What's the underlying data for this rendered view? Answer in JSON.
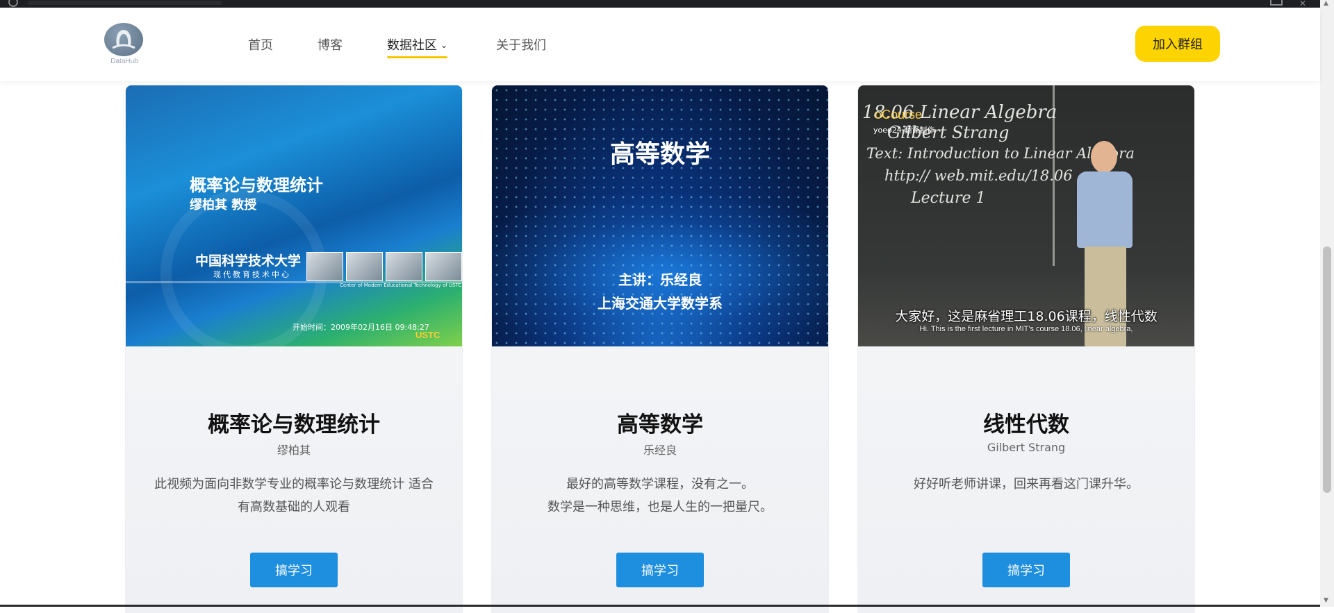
{
  "navbar": {
    "logo_text": "DataHub",
    "items": [
      {
        "label": "首页"
      },
      {
        "label": "博客"
      },
      {
        "label": "数据社区"
      },
      {
        "label": "关于我们"
      }
    ],
    "join_button": "加入群组"
  },
  "cards": [
    {
      "thumb": {
        "title": "概率论与数理统计",
        "subtitle": "缪柏其 教授",
        "org_cn": "中国科学技术大学",
        "org_cn2": "现代教育技术中心",
        "org_en": "Center of Modern Educational Technology of USTC",
        "time": "开始时间：2009年02月16日 09:48:27",
        "mark": "USTC"
      },
      "title": "概率论与数理统计",
      "author": "缪柏其",
      "desc": "此视频为面向非数学专业的概率论与数理统计 适合有高数基础的人观看",
      "button": "搞学习"
    },
    {
      "thumb": {
        "title": "高等数学",
        "line1": "主讲：乐经良",
        "line2": "上海交通大学数学系"
      },
      "title": "高等数学",
      "author": "乐经良",
      "desc_lines": [
        "最好的高等数学课程，没有之一。",
        "数学是一种思维，也是人生的一把量尺。"
      ],
      "button": "搞学习"
    },
    {
      "thumb": {
        "brand": "oCourse",
        "brand_sub": "yoeo24 翻译制作",
        "chalk1": "18.06 Linear Algebra",
        "chalk2": "Gilbert Strang",
        "chalk3": "Text: Introduction to Linear Algebra",
        "chalk4": "http:// web.mit.edu/18.06",
        "chalk5": "Lecture 1",
        "sub_cn": "大家好，这是麻省理工18.06课程，线性代数",
        "sub_en": "Hi. This is the first lecture in MIT's course 18.06, linear algebra,"
      },
      "title": "线性代数",
      "author": "Gilbert Strang",
      "desc": "好好听老师讲课，回来再看这门课升华。",
      "button": "搞学习"
    }
  ]
}
